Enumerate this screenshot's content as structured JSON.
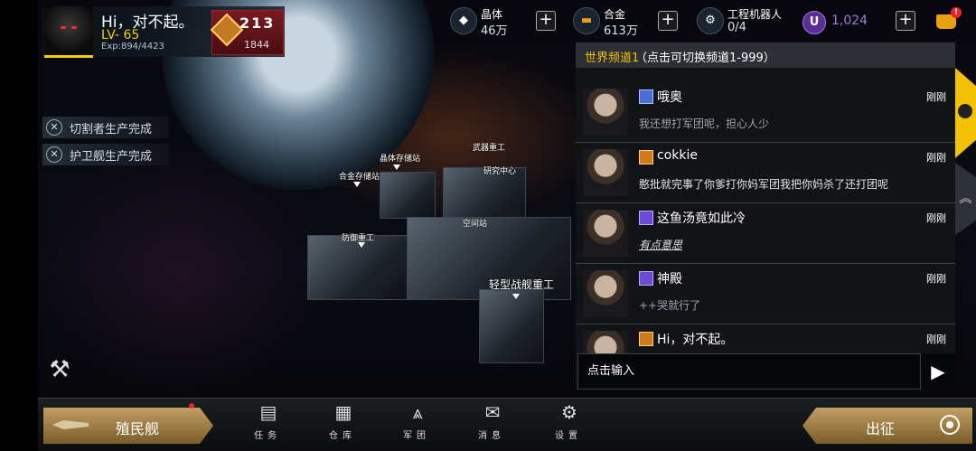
{
  "player": {
    "name": "Hi，对不起。",
    "level": "LV- 65",
    "exp": "Exp:894/4423",
    "rank_icon": "213",
    "rank_value": "1844"
  },
  "resources": [
    {
      "label": "晶体",
      "value": "46万",
      "icon": "crystal-icon"
    },
    {
      "label": "合金",
      "value": "613万",
      "icon": "alloy-icon"
    },
    {
      "label": "工程机器人",
      "value": "0/4",
      "icon": "robot-icon"
    }
  ],
  "currency": {
    "icon_letter": "U",
    "value": "1,024"
  },
  "notifications": [
    "切割者生产完成",
    "护卫舰生产完成"
  ],
  "station_labels": {
    "crystal": "晶体存储站",
    "alloy": "合金存储站",
    "weapon": "武器重工",
    "research": "研究中心",
    "space": "空间站",
    "defense": "防御重工",
    "light": "轻型战舰重工"
  },
  "chat": {
    "channel": "世界频道1",
    "hint": "（点击可切换频道1-999）",
    "messages": [
      {
        "name": "哦奥",
        "time": "刚刚",
        "text": "我还想打军团呢，担心人少",
        "rank": "blue"
      },
      {
        "name": "cokkie",
        "time": "刚刚",
        "text": "憨批就完事了你爹打你妈军团我把你妈杀了还打团呢",
        "rank": "orange"
      },
      {
        "name": "这鱼汤竟如此冷",
        "time": "刚刚",
        "text": "有点意思",
        "rank": "purple"
      },
      {
        "name": "神殿",
        "time": "刚刚",
        "text": "++哭就行了",
        "rank": "purple"
      },
      {
        "name": "Hi，对不起。",
        "time": "刚刚",
        "text": "",
        "rank": "orange"
      }
    ],
    "input_placeholder": "点击输入"
  },
  "bottom_nav": {
    "colony": "殖民舰",
    "items": [
      "任务",
      "仓库",
      "军团",
      "消息",
      "设置"
    ],
    "expedition": "出征"
  },
  "colors": {
    "accent_yellow": "#f2c200",
    "level_yellow": "#f2d000",
    "currency_purple": "#a07ad8",
    "gold_button": "#c2a064"
  }
}
